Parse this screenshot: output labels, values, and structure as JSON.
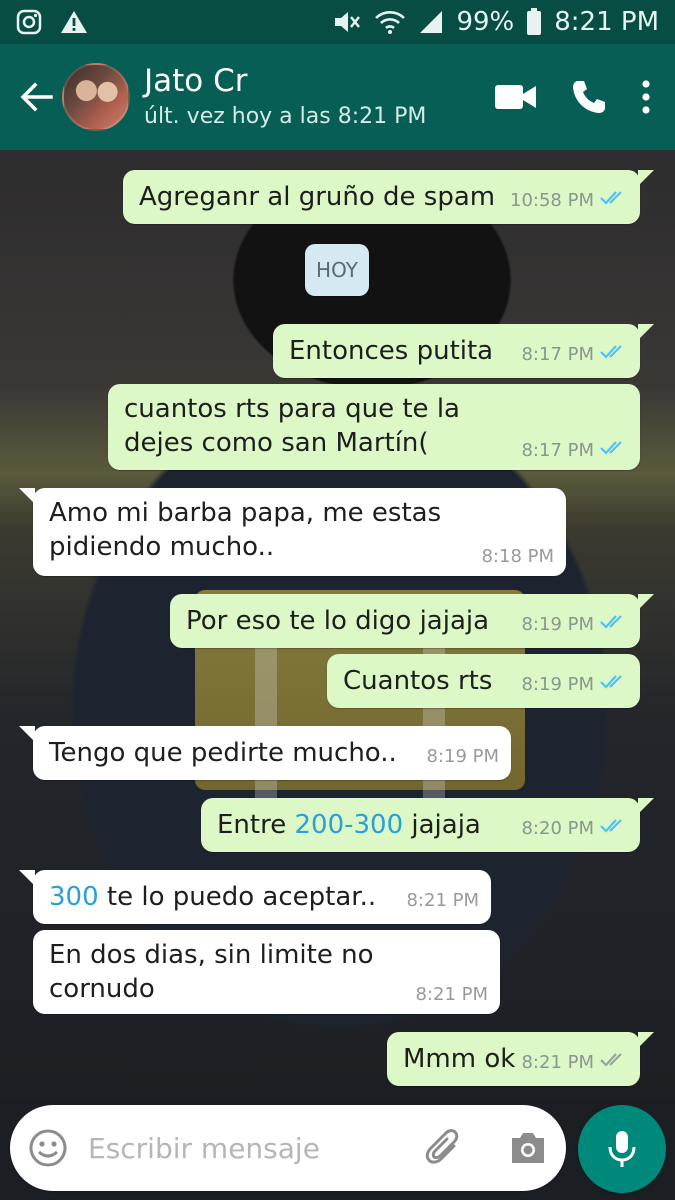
{
  "status_bar": {
    "battery": "99%",
    "time": "8:21 PM",
    "icons": [
      "instagram-icon",
      "warning-icon",
      "mute-icon",
      "wifi-icon",
      "signal-icon",
      "battery-icon"
    ]
  },
  "header": {
    "contact_name": "Jato Cr",
    "last_seen": "últ. vez hoy a las 8:21 PM"
  },
  "chat": {
    "date_chip": "HOY",
    "messages": [
      {
        "dir": "out",
        "text": "Agreganr al gruño de spam",
        "time": "10:58 PM",
        "ticks": "read"
      },
      {
        "dir": "out",
        "text": "Entonces putita",
        "time": "8:17 PM",
        "ticks": "read"
      },
      {
        "dir": "out",
        "text": "cuantos rts para que te la dejes como san Martín(",
        "time": "8:17 PM",
        "ticks": "read"
      },
      {
        "dir": "in",
        "text": "Amo mi barba papa, me estas pidiendo mucho..",
        "time": "8:18 PM"
      },
      {
        "dir": "out",
        "text": "Por eso te lo digo jajaja",
        "time": "8:19 PM",
        "ticks": "read"
      },
      {
        "dir": "out",
        "text": "Cuantos rts",
        "time": "8:19 PM",
        "ticks": "read"
      },
      {
        "dir": "in",
        "text": "Tengo que pedirte mucho..",
        "time": "8:19 PM"
      },
      {
        "dir": "out",
        "text_pre": "Entre ",
        "text_link": "200-300",
        "text_post": " jajaja",
        "time": "8:20 PM",
        "ticks": "read"
      },
      {
        "dir": "in",
        "text_link": "300",
        "text_post": " te lo puedo aceptar..",
        "time": "8:21 PM"
      },
      {
        "dir": "in",
        "text": "En dos dias, sin limite no cornudo",
        "time": "8:21 PM"
      },
      {
        "dir": "out",
        "text": "Mmm ok",
        "time": "8:21 PM",
        "ticks": "delivered"
      }
    ]
  },
  "composer": {
    "placeholder": "Escribir mensaje"
  },
  "colors": {
    "header": "#075e54",
    "status_bar": "#074d44",
    "outgoing_bubble": "#dcf8c6",
    "incoming_bubble": "#ffffff",
    "read_ticks": "#4fc3f7",
    "mic_button": "#00897b"
  }
}
